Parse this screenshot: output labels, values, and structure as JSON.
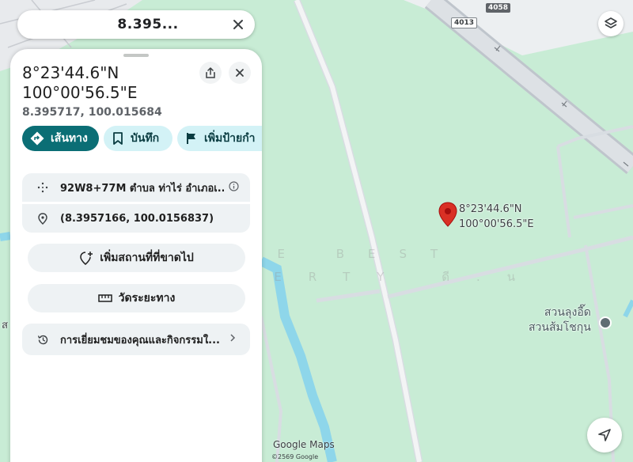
{
  "search": {
    "query": "8.395..."
  },
  "panel": {
    "title_line1": "8°23'44.6\"N",
    "title_line2": "100°00'56.5\"E",
    "decimal_coords": "8.395717, 100.015684",
    "chips": [
      {
        "label": "เส้นทาง",
        "icon": "directions-icon"
      },
      {
        "label": "บันทึก",
        "icon": "bookmark-icon"
      },
      {
        "label": "เพิ่มป้ายกำ",
        "icon": "flag-icon"
      }
    ],
    "plus_code": "92W8+77M ตำบล ท่าไร่ อำเภอเ...",
    "latlng": "(8.3957166, 100.0156837)",
    "add_missing_place": "เพิ่มสถานที่ที่ขาดไป",
    "measure_distance": "วัดระยะทาง",
    "activity": "การเยี่ยมชมของคุณและกิจกรรมใ..."
  },
  "map": {
    "pin_line1": "8°23'44.6\"N",
    "pin_line2": "100°00'56.5\"E",
    "poi_line1": "สวนลุงอี๊ด",
    "poi_line2": "สวนส้มโชกุน",
    "road_4058": "4058",
    "road_4013": "4013",
    "edge_label": "ส",
    "watermark_1": "THE BEST",
    "watermark_2": "PROPERTY ดี.น",
    "brand": "Google Maps",
    "copyright": "©2569 Google"
  },
  "colors": {
    "primary": "#0b6e75",
    "chip_bg": "#d3f2f6",
    "map_green": "#c8ecd5",
    "water": "#8ed6ea",
    "pin": "#d93025"
  }
}
